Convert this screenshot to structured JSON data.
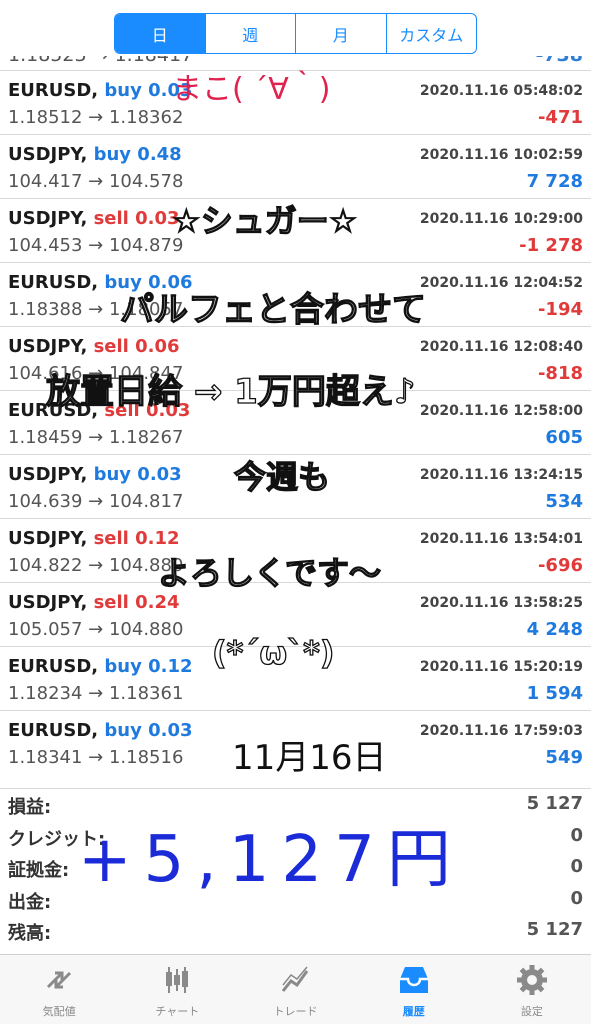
{
  "period_tabs": [
    {
      "label": "日",
      "active": true
    },
    {
      "label": "週",
      "active": false
    },
    {
      "label": "月",
      "active": false
    },
    {
      "label": "カスタム",
      "active": false
    }
  ],
  "trades": [
    {
      "symbol": "EURUSD,",
      "side": "buy 0.03",
      "side_type": "buy",
      "time": "2020.11.16 05:48:02",
      "prices": "1.18512 → 1.18362",
      "profit": "-471",
      "profit_type": "neg"
    },
    {
      "symbol": "USDJPY,",
      "side": "buy 0.48",
      "side_type": "buy",
      "time": "2020.11.16 10:02:59",
      "prices": "104.417 → 104.578",
      "profit": "7 728",
      "profit_type": "pos"
    },
    {
      "symbol": "USDJPY,",
      "side": "sell 0.03",
      "side_type": "sell",
      "time": "2020.11.16 10:29:00",
      "prices": "104.453 → 104.879",
      "profit": "-1 278",
      "profit_type": "neg"
    },
    {
      "symbol": "EURUSD,",
      "side": "buy 0.06",
      "side_type": "buy",
      "time": "2020.11.16 12:04:52",
      "prices": "1.18388 → 1.18057",
      "profit": "-194",
      "profit_type": "neg"
    },
    {
      "symbol": "USDJPY,",
      "side": "sell 0.06",
      "side_type": "sell",
      "time": "2020.11.16 12:08:40",
      "prices": "104.616 → 104.847",
      "profit": "-818",
      "profit_type": "neg"
    },
    {
      "symbol": "EURUSD,",
      "side": "sell 0.03",
      "side_type": "sell",
      "time": "2020.11.16 12:58:00",
      "prices": "1.18459 → 1.18267",
      "profit": "605",
      "profit_type": "pos"
    },
    {
      "symbol": "USDJPY,",
      "side": "buy 0.03",
      "side_type": "buy",
      "time": "2020.11.16 13:24:15",
      "prices": "104.639 → 104.817",
      "profit": "534",
      "profit_type": "pos"
    },
    {
      "symbol": "USDJPY,",
      "side": "sell 0.12",
      "side_type": "sell",
      "time": "2020.11.16 13:54:01",
      "prices": "104.822 → 104.880",
      "profit": "-696",
      "profit_type": "neg"
    },
    {
      "symbol": "USDJPY,",
      "side": "sell 0.24",
      "side_type": "sell",
      "time": "2020.11.16 13:58:25",
      "prices": "105.057 → 104.880",
      "profit": "4 248",
      "profit_type": "pos"
    },
    {
      "symbol": "EURUSD,",
      "side": "buy 0.12",
      "side_type": "buy",
      "time": "2020.11.16 15:20:19",
      "prices": "1.18234 → 1.18361",
      "profit": "1 594",
      "profit_type": "pos"
    },
    {
      "symbol": "EURUSD,",
      "side": "buy 0.03",
      "side_type": "buy",
      "time": "2020.11.16 17:59:03",
      "prices": "1.18341 → 1.18516",
      "profit": "549",
      "profit_type": "pos"
    }
  ],
  "summary": [
    {
      "label": "損益:",
      "value": "5 127"
    },
    {
      "label": "クレジット:",
      "value": "0"
    },
    {
      "label": "証拠金:",
      "value": "0"
    },
    {
      "label": "出金:",
      "value": "0"
    },
    {
      "label": "残高:",
      "value": "5 127"
    }
  ],
  "overlay": {
    "line1": "まこ( ´∀｀)",
    "line2": "☆シュガー☆",
    "line3": "パルフェと合わせて",
    "line4": "放置日給 → 1万円超え♪",
    "line5": "今週も",
    "line6": "よろしくです〜",
    "line7": "(*´ω`*)",
    "line8": "11月16日",
    "total": "+5,127円"
  },
  "tabbar": [
    {
      "label": "気配値",
      "icon": "quotes-icon",
      "active": false
    },
    {
      "label": "チャート",
      "icon": "chart-icon",
      "active": false
    },
    {
      "label": "トレード",
      "icon": "trade-icon",
      "active": false
    },
    {
      "label": "履歴",
      "icon": "history-icon",
      "active": true
    },
    {
      "label": "設定",
      "icon": "settings-icon",
      "active": false
    }
  ],
  "colors": {
    "accent": "#1a8cff",
    "buy": "#1f7ae0",
    "sell": "#e03a3a",
    "handwrite_blue": "#1b2bd8",
    "handwrite_red": "#e0234e"
  }
}
